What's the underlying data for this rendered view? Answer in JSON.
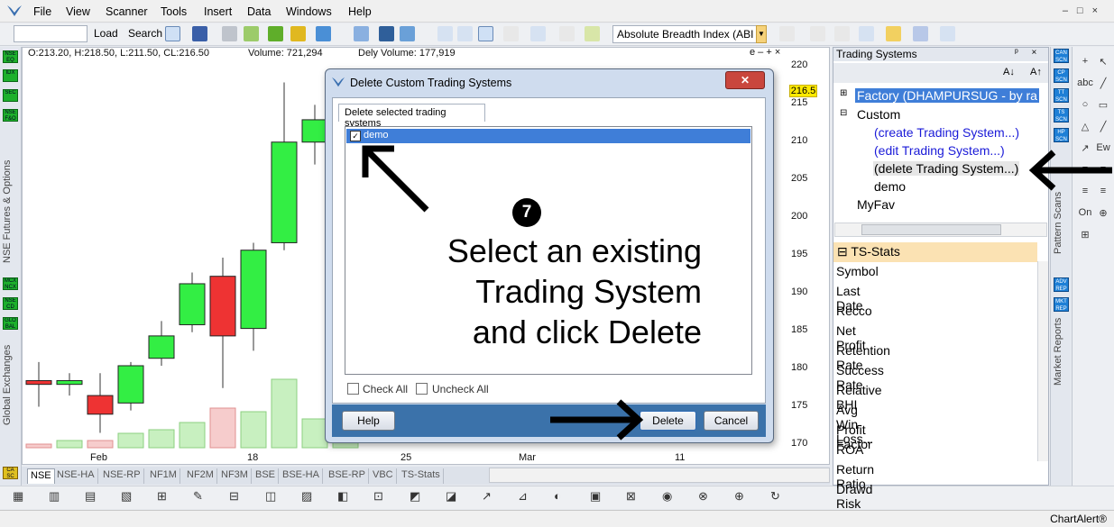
{
  "menu": {
    "items": [
      "File",
      "View",
      "Scanner",
      "Tools",
      "Insert",
      "Data",
      "Windows",
      "Help"
    ]
  },
  "toolbar": {
    "load": "Load",
    "search": "Search",
    "indicator": "Absolute Breadth Index (ABI"
  },
  "chart": {
    "info": {
      "ohlc": "O:213.20, H:218.50, L:211.50, CL:216.50",
      "volume": "Volume: 721,294",
      "dely_volume": "Dely Volume: 177,919"
    },
    "price_badge": "216.5",
    "y_ticks": [
      "220",
      "215",
      "210",
      "205",
      "200",
      "195",
      "190",
      "185",
      "180",
      "175",
      "170"
    ],
    "x_ticks": [
      "Feb",
      "18",
      "25",
      "Mar",
      "11"
    ],
    "window_controls": "e – + ×",
    "up_color": "#33ee44",
    "down_color": "#ee3333"
  },
  "chart_data": {
    "type": "candlestick",
    "x": [
      "c1",
      "c2",
      "c3",
      "c4",
      "c5",
      "c6",
      "c7",
      "c8",
      "c9",
      "c10",
      "c11"
    ],
    "ohlc": [
      [
        179.0,
        181.5,
        175.5,
        178.5
      ],
      [
        178.5,
        180.0,
        177.0,
        179.0
      ],
      [
        177.0,
        180.0,
        172.0,
        174.5
      ],
      [
        176.0,
        181.5,
        175.0,
        181.0
      ],
      [
        182.0,
        187.0,
        181.0,
        185.0
      ],
      [
        186.5,
        193.5,
        185.5,
        192.0
      ],
      [
        193.0,
        195.5,
        178.0,
        185.0
      ],
      [
        186.0,
        197.5,
        183.0,
        196.5
      ],
      [
        197.5,
        219.0,
        196.5,
        211.0
      ],
      [
        211.0,
        216.0,
        208.0,
        214.0
      ],
      [
        213.2,
        218.5,
        211.5,
        216.5
      ]
    ],
    "volume_rel": [
      0.05,
      0.1,
      0.1,
      0.2,
      0.25,
      0.35,
      0.55,
      0.5,
      0.95,
      0.4,
      0.3
    ],
    "ylim": [
      170,
      221
    ]
  },
  "tabs": [
    "NSE",
    "NSE-HA",
    "NSE-RP",
    "NF1M",
    "NF2M",
    "NF3M",
    "BSE",
    "BSE-HA",
    "BSE-RP",
    "VBC",
    "TS-Stats"
  ],
  "left_strip": {
    "badges1": [
      "NSE EQ",
      "IDX",
      "SEC",
      "NSE F&O"
    ],
    "label1": "NSE Futures & Options",
    "badges2": [
      "MCX NCX",
      "NSE CD",
      "GLO BAL"
    ],
    "label2": "Global Exchanges",
    "badge3": "CA SC"
  },
  "right_panel": {
    "title": "Trading Systems",
    "controls": "ᵖ ×",
    "sort_az": "A↓",
    "sort_za": "A↑",
    "tree": {
      "factory": "Factory (DHAMPURSUG - by ra",
      "custom": "Custom",
      "create": "(create Trading System...)",
      "edit": "(edit Trading System...)",
      "delete": "(delete Trading System...)",
      "demo": "demo",
      "myfav": "MyFav"
    },
    "ts_stats": {
      "header": "TS-Stats",
      "items": [
        "Symbol",
        "Last Date",
        "Recco",
        "Net Profit",
        "Retention Rate",
        "Success Rate",
        "Relative BHI",
        "Avg Win-Loss...",
        "Profit Factor",
        "ROA",
        "Return Ratio",
        "Drawd Risk"
      ]
    }
  },
  "right_strip": {
    "badges1": [
      "CAN SCN",
      "CP SCN",
      "TT SCN",
      "TS SCN",
      "HP SCN"
    ],
    "label1": "Pattern Scans",
    "badges2": [
      "ADV REP",
      "MKT REP"
    ],
    "label2": "Market Reports"
  },
  "draw_tools": [
    "+",
    "↖",
    "abc",
    "╱",
    "○",
    "▭",
    "△",
    "╱",
    "↗",
    "Ew",
    "≡",
    "≡",
    "≡",
    "≡",
    "On",
    "⊕",
    "⊞"
  ],
  "dialog": {
    "title": "Delete Custom Trading Systems",
    "tab": "Delete selected trading systems",
    "item": "demo",
    "check_all": "Check All",
    "uncheck_all": "Uncheck All",
    "help": "Help",
    "delete": "Delete",
    "cancel": "Cancel"
  },
  "annotation": {
    "step": "7",
    "line1": "Select an existing",
    "line2": "Trading System",
    "line3": "and click Delete"
  },
  "status": {
    "brand": "ChartAlert®"
  }
}
